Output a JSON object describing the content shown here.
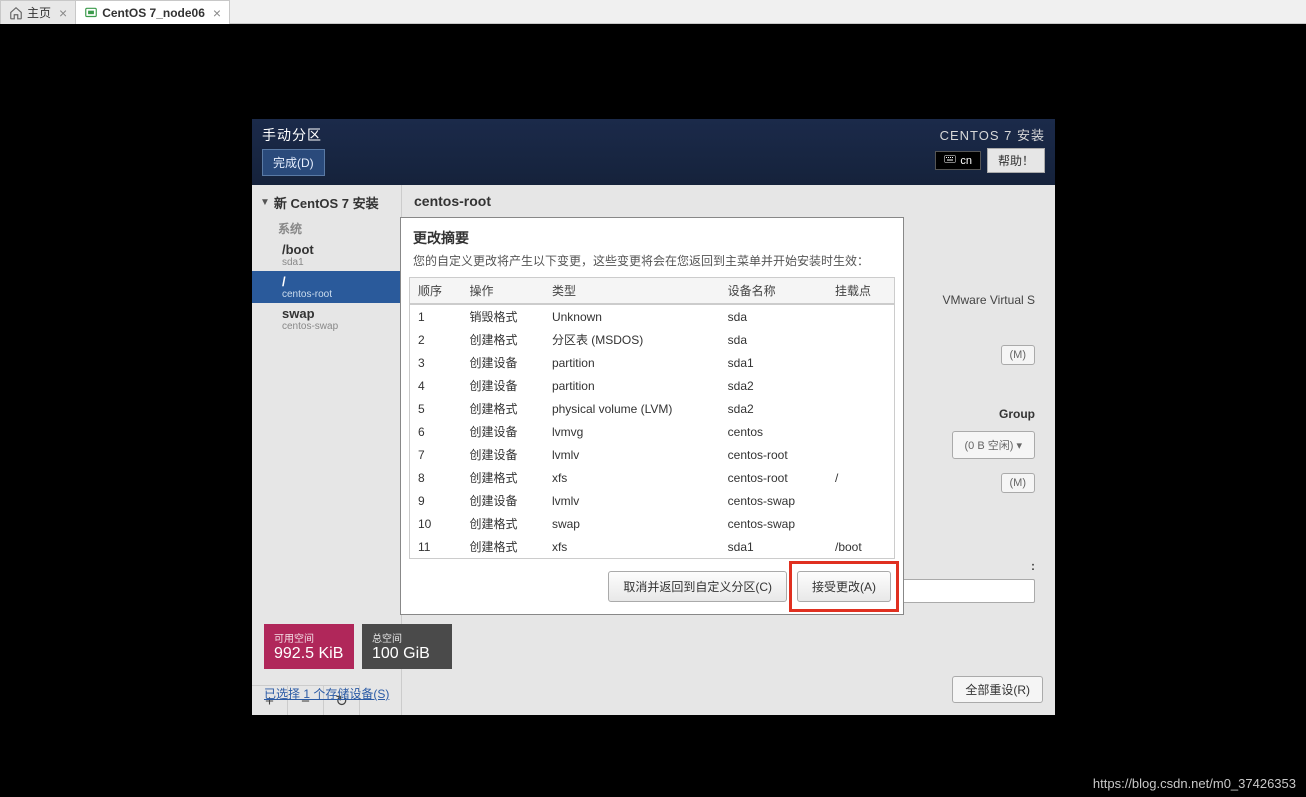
{
  "tabs": [
    {
      "label": "主页",
      "icon": "home"
    },
    {
      "label": "CentOS 7_node06",
      "icon": "vm"
    }
  ],
  "installer": {
    "title": "手动分区",
    "done": "完成(D)",
    "product": "CENTOS 7 安装",
    "keyboard": "cn",
    "help": "帮助！"
  },
  "partitions": {
    "section": "新 CentOS 7 安装",
    "system": "系统",
    "items": [
      {
        "name": "/boot",
        "sub": "sda1"
      },
      {
        "name": "/",
        "sub": "centos-root"
      },
      {
        "name": "swap",
        "sub": "centos-swap"
      }
    ]
  },
  "right": {
    "title": "centos-root",
    "device": "VMware Virtual S",
    "modify": "(M)",
    "vg_label": "Group",
    "vg_free": "(0 B 空闲) ▾",
    "vg_modify": "(M)",
    "colon": ":"
  },
  "footer": {
    "free_label": "可用空间",
    "free_value": "992.5 KiB",
    "total_label": "总空间",
    "total_value": "100 GiB",
    "storage_link": "已选择 1 个存储设备(S)",
    "reset": "全部重设(R)"
  },
  "dialog": {
    "title": "更改摘要",
    "subtitle": "您的自定义更改将产生以下变更，这些变更将会在您返回到主菜单并开始安装时生效：",
    "cols": {
      "order": "顺序",
      "action": "操作",
      "type": "类型",
      "device": "设备名称",
      "mount": "挂载点"
    },
    "rows": [
      {
        "order": "1",
        "action": "销毁格式",
        "cls": "destroy",
        "type": "Unknown",
        "device": "sda",
        "mount": ""
      },
      {
        "order": "2",
        "action": "创建格式",
        "cls": "create",
        "type": "分区表 (MSDOS)",
        "device": "sda",
        "mount": ""
      },
      {
        "order": "3",
        "action": "创建设备",
        "cls": "create",
        "type": "partition",
        "device": "sda1",
        "mount": ""
      },
      {
        "order": "4",
        "action": "创建设备",
        "cls": "create",
        "type": "partition",
        "device": "sda2",
        "mount": ""
      },
      {
        "order": "5",
        "action": "创建格式",
        "cls": "create",
        "type": "physical volume (LVM)",
        "device": "sda2",
        "mount": ""
      },
      {
        "order": "6",
        "action": "创建设备",
        "cls": "create",
        "type": "lvmvg",
        "device": "centos",
        "mount": ""
      },
      {
        "order": "7",
        "action": "创建设备",
        "cls": "create",
        "type": "lvmlv",
        "device": "centos-root",
        "mount": ""
      },
      {
        "order": "8",
        "action": "创建格式",
        "cls": "create",
        "type": "xfs",
        "device": "centos-root",
        "mount": "/"
      },
      {
        "order": "9",
        "action": "创建设备",
        "cls": "create",
        "type": "lvmlv",
        "device": "centos-swap",
        "mount": ""
      },
      {
        "order": "10",
        "action": "创建格式",
        "cls": "create",
        "type": "swap",
        "device": "centos-swap",
        "mount": ""
      },
      {
        "order": "11",
        "action": "创建格式",
        "cls": "create",
        "type": "xfs",
        "device": "sda1",
        "mount": "/boot"
      }
    ],
    "cancel": "取消并返回到自定义分区(C)",
    "accept": "接受更改(A)"
  },
  "watermark": "https://blog.csdn.net/m0_37426353"
}
